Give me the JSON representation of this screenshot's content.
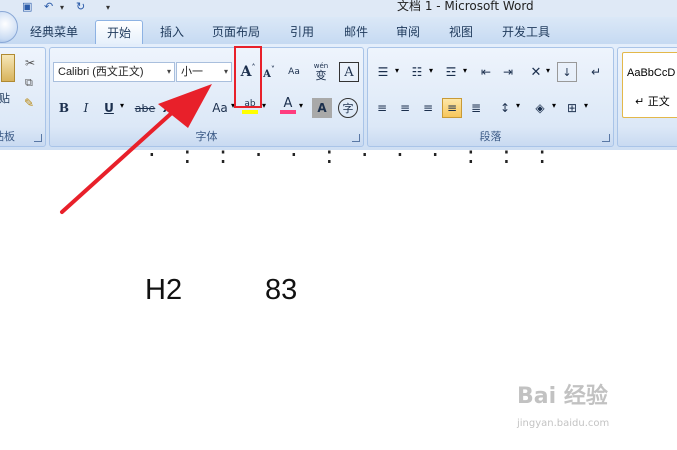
{
  "app": {
    "window_title": "文档 1 - Microsoft Word"
  },
  "qat": {
    "save_icon": "save-icon",
    "undo_icon": "undo-icon",
    "redo_icon": "redo-icon"
  },
  "tabs": [
    {
      "label": "经典菜单"
    },
    {
      "label": "开始"
    },
    {
      "label": "插入"
    },
    {
      "label": "页面布局"
    },
    {
      "label": "引用"
    },
    {
      "label": "邮件"
    },
    {
      "label": "审阅"
    },
    {
      "label": "视图"
    },
    {
      "label": "开发工具"
    }
  ],
  "active_tab": "开始",
  "clipboard": {
    "paste_label": "贴",
    "group_label": "贴板"
  },
  "font": {
    "font_name": "Calibri (西文正文)",
    "font_size": "小一",
    "grow_font": "A",
    "shrink_font": "A",
    "bold": "B",
    "italic": "I",
    "underline": "U",
    "strikethrough": "abe",
    "subscript": "x",
    "superscript": "x",
    "change_case": "Aa",
    "highlight": "ab",
    "font_color": "A",
    "char_shading": "A",
    "enclose": "字",
    "pinyin": "wén",
    "border": "A",
    "group_label": "字体"
  },
  "paragraph": {
    "group_label": "段落"
  },
  "styles": {
    "normal_preview": "AaBbCcD",
    "normal_label": "正文"
  },
  "document": {
    "partial_line": "·  :  :  ·  ·  :  ·  ·  ·  :  :  :",
    "text1": "H2",
    "text2": "83"
  },
  "watermark": {
    "main": "Bai 经验",
    "sub": "jingyan.baidu.com"
  },
  "colors": {
    "annotation_red": "#e8202a",
    "highlight_yellow": "#ffff00",
    "font_color_red": "#ff0000"
  }
}
